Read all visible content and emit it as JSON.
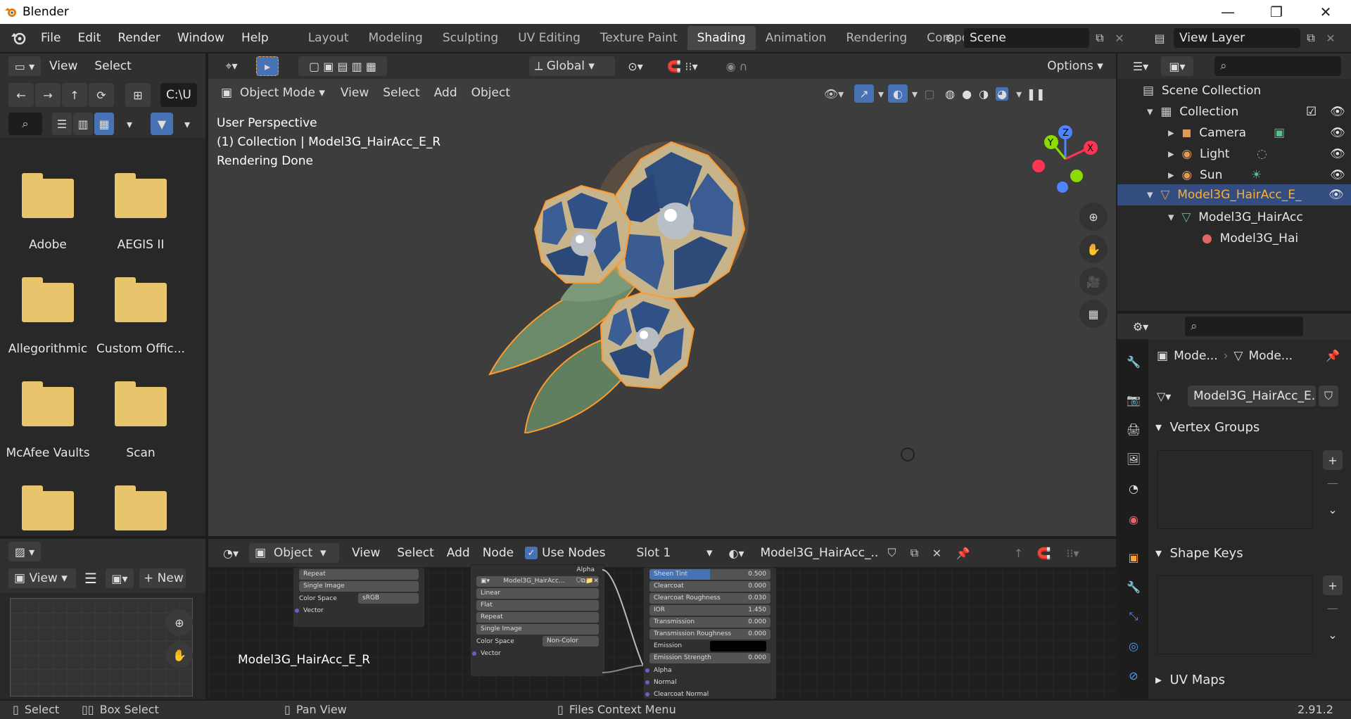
{
  "window": {
    "title": "Blender",
    "minimize": "—",
    "restore": "❐",
    "close": "✕"
  },
  "menubar": {
    "items": [
      "File",
      "Edit",
      "Render",
      "Window",
      "Help"
    ]
  },
  "workspaces": [
    "Layout",
    "Modeling",
    "Sculpting",
    "UV Editing",
    "Texture Paint",
    "Shading",
    "Animation",
    "Rendering",
    "Compos"
  ],
  "active_workspace": "Shading",
  "scene": {
    "name": "Scene",
    "view_layer": "View Layer"
  },
  "file_browser": {
    "header": {
      "view": "View",
      "select": "Select"
    },
    "path": "C:\\U",
    "folders": [
      "Adobe",
      "AEGIS II",
      "Allegorithmic",
      "Custom Offic...",
      "McAfee Vaults",
      "Scan"
    ]
  },
  "viewport": {
    "toolbar": {
      "orientation": "Global",
      "options": "Options"
    },
    "header": {
      "mode": "Object Mode",
      "view": "View",
      "select": "Select",
      "add": "Add",
      "object": "Object"
    },
    "overlay_text": [
      "User Perspective",
      "(1) Collection | Model3G_HairAcc_E_R",
      "Rendering Done"
    ],
    "gizmo": {
      "x": "X",
      "y": "Y",
      "z": "Z"
    }
  },
  "outliner": {
    "root": "Scene Collection",
    "items": [
      {
        "label": "Collection",
        "level": 1
      },
      {
        "label": "Camera",
        "level": 2
      },
      {
        "label": "Light",
        "level": 2
      },
      {
        "label": "Sun",
        "level": 2
      },
      {
        "label": "Model3G_HairAcc_E_",
        "level": 1
      },
      {
        "label": "Model3G_HairAcc",
        "level": 2
      },
      {
        "label": "Model3G_Hai",
        "level": 3
      }
    ]
  },
  "properties": {
    "breadcrumb": [
      "Mode...",
      "Mode..."
    ],
    "mesh_name": "Model3G_HairAcc_E...",
    "panels": [
      "Vertex Groups",
      "Shape Keys",
      "UV Maps"
    ]
  },
  "image_editor": {
    "view": "View",
    "new": "New",
    "name": "Model3G_HairAcc_E_R"
  },
  "node_editor": {
    "header": {
      "object": "Object",
      "view": "View",
      "select": "Select",
      "add": "Add",
      "node": "Node",
      "use_nodes": "Use Nodes",
      "slot": "Slot 1",
      "material": "Model3G_HairAcc_..."
    },
    "node1": {
      "fields": [
        "Repeat",
        "Single Image"
      ],
      "color_space_label": "Color Space",
      "color_space": "sRGB",
      "socket": "Vector"
    },
    "node2": {
      "alpha": "Alpha",
      "image": "Model3G_HairAcc...",
      "fields": [
        "Linear",
        "Flat",
        "Repeat",
        "Single Image"
      ],
      "color_space_label": "Color Space",
      "color_space": "Non-Color",
      "socket": "Vector"
    },
    "bsdf": [
      {
        "label": "Sheen Tint",
        "value": "0.500"
      },
      {
        "label": "Clearcoat",
        "value": "0.000"
      },
      {
        "label": "Clearcoat Roughness",
        "value": "0.030"
      },
      {
        "label": "IOR",
        "value": "1.450"
      },
      {
        "label": "Transmission",
        "value": "0.000"
      },
      {
        "label": "Transmission Roughness",
        "value": "0.000"
      },
      {
        "label": "Emission",
        "value": ""
      },
      {
        "label": "Emission Strength",
        "value": "0.000"
      }
    ],
    "bsdf_sockets": [
      "Alpha",
      "Normal",
      "Clearcoat Normal"
    ]
  },
  "statusbar": {
    "select": "Select",
    "box_select": "Box Select",
    "pan_view": "Pan View",
    "context": "Files Context Menu",
    "version": "2.91.2"
  },
  "colors": {
    "accent": "#4772b3",
    "selection": "#ffa033",
    "folder": "#e8c56c"
  }
}
